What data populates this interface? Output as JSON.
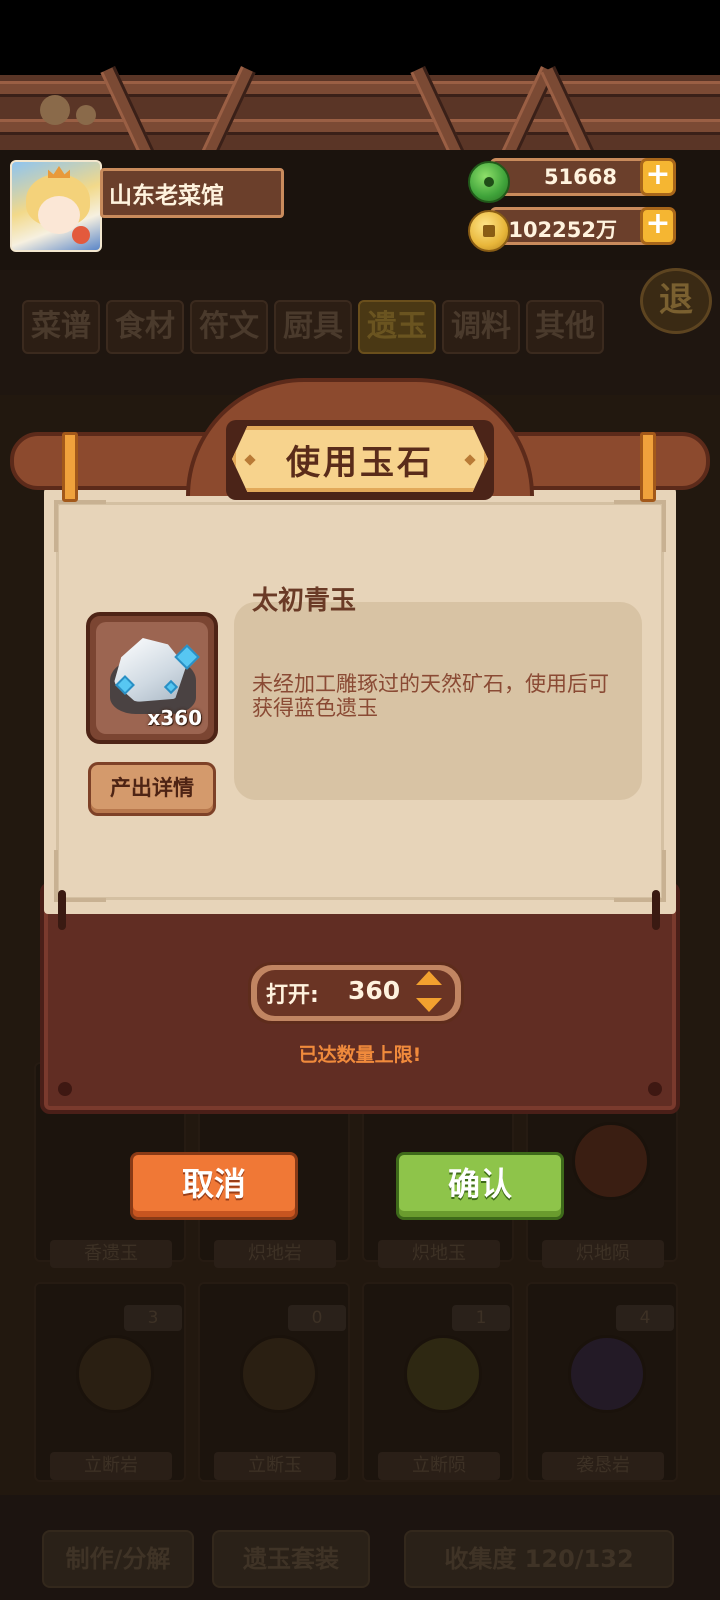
{
  "header": {
    "player_name": "山东老菜馆",
    "jade_amount": "51668",
    "coin_amount": "102252万",
    "back_label": "退"
  },
  "tabs": [
    {
      "label": "菜谱"
    },
    {
      "label": "食材"
    },
    {
      "label": "符文"
    },
    {
      "label": "厨具"
    },
    {
      "label": "遗玉"
    },
    {
      "label": "调料"
    },
    {
      "label": "其他"
    }
  ],
  "grid": {
    "row1": [
      "香遗玉",
      "炽地岩",
      "炽地玉",
      "炽地陨"
    ],
    "row2": [
      {
        "count": "3",
        "label": "立断岩"
      },
      {
        "count": "0",
        "label": "立断玉"
      },
      {
        "count": "1",
        "label": "立断陨"
      },
      {
        "count": "4",
        "label": "袭恳岩"
      }
    ]
  },
  "bottom_bar": {
    "craft_label": "制作/分解",
    "set_label": "遗玉套装",
    "collection_label": "收集度 120/132"
  },
  "dialog": {
    "title": "使用玉石",
    "item_name": "太初青玉",
    "item_count": "x360",
    "item_description": "未经加工雕琢过的天然矿石，使用后可获得蓝色遗玉",
    "detail_button": "产出详情",
    "open_label": "打开:",
    "open_value": "360",
    "limit_notice": "已达数量上限!",
    "cancel_button": "取消",
    "confirm_button": "确认"
  }
}
